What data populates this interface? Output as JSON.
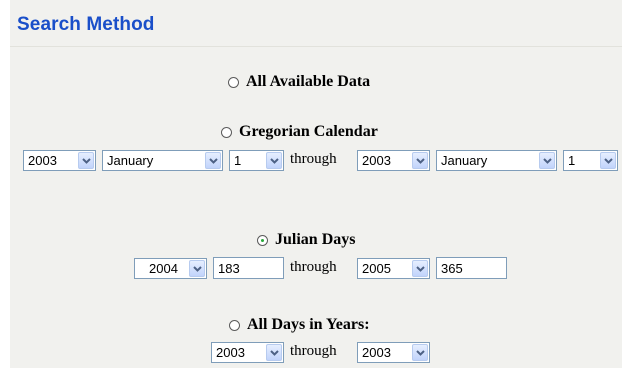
{
  "section": {
    "title": "Search Method"
  },
  "options": {
    "all_data": {
      "label": "All Available Data",
      "selected": false
    },
    "gregorian": {
      "label": "Gregorian Calendar",
      "selected": false
    },
    "julian": {
      "label": "Julian Days",
      "selected": true
    },
    "all_years": {
      "label": "All Days in Years:",
      "selected": false
    }
  },
  "gregorian_range": {
    "start_year": "2003",
    "start_month": "January",
    "start_day": "1",
    "through_label": "through",
    "end_year": "2003",
    "end_month": "January",
    "end_day": "1"
  },
  "julian_range": {
    "start_year": "2004",
    "start_day": "183",
    "through_label": "through",
    "end_year": "2005",
    "end_day": "365"
  },
  "years_range": {
    "start_year": "2003",
    "through_label": "through",
    "end_year": "2003"
  },
  "icons": {
    "radio": "radio-button-icon",
    "dropdown": "chevron-down-icon"
  }
}
